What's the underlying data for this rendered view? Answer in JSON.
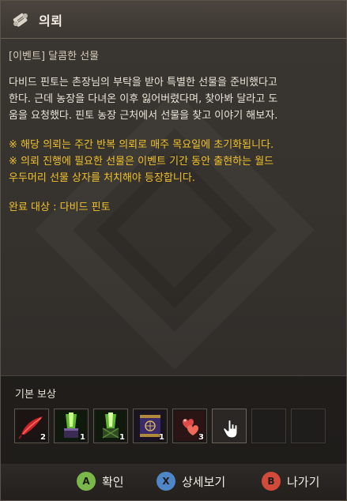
{
  "window": {
    "title": "의뢰",
    "title_icon": "scroll-icon"
  },
  "quest": {
    "name": "[이벤트] 달콤한 선물",
    "description_lines": [
      "다비드 핀토는 촌장님의 부탁을 받아 특별한 선물을 준비했다고",
      "한다. 근데 농장을 다녀온 이후 잃어버렸다며, 찾아봐 달라고 도",
      "움을 요청했다. 핀토 농장 근처에서 선물을 찾고 이야기 해보자."
    ],
    "note_lines": [
      "※ 해당 의뢰는 주간 반복 의뢰로 매주 목요일에 초기화됩니다.",
      "※ 의뢰 진행에 필요한 선물은 이벤트 기간 동안 출현하는 월드",
      "우두머리 선물 상자를 처치해야 등장합니다."
    ],
    "target_label": "완료 대상 : 다비드 핀토"
  },
  "rewards": {
    "title": "기본 보상",
    "items": [
      {
        "icon": "red-feather-icon",
        "count": "2"
      },
      {
        "icon": "green-flame-box-icon",
        "count": "1"
      },
      {
        "icon": "green-flame-crate-icon",
        "count": "1"
      },
      {
        "icon": "purple-banner-icon",
        "count": "1"
      },
      {
        "icon": "red-hearts-icon",
        "count": "3"
      }
    ],
    "empty_slots": 3
  },
  "footer": {
    "confirm": {
      "key": "A",
      "label": "확인",
      "color": "#7bb84a"
    },
    "details": {
      "key": "X",
      "label": "상세보기",
      "color": "#4f86c8"
    },
    "exit": {
      "key": "B",
      "label": "나가기",
      "color": "#d24b3a"
    }
  }
}
